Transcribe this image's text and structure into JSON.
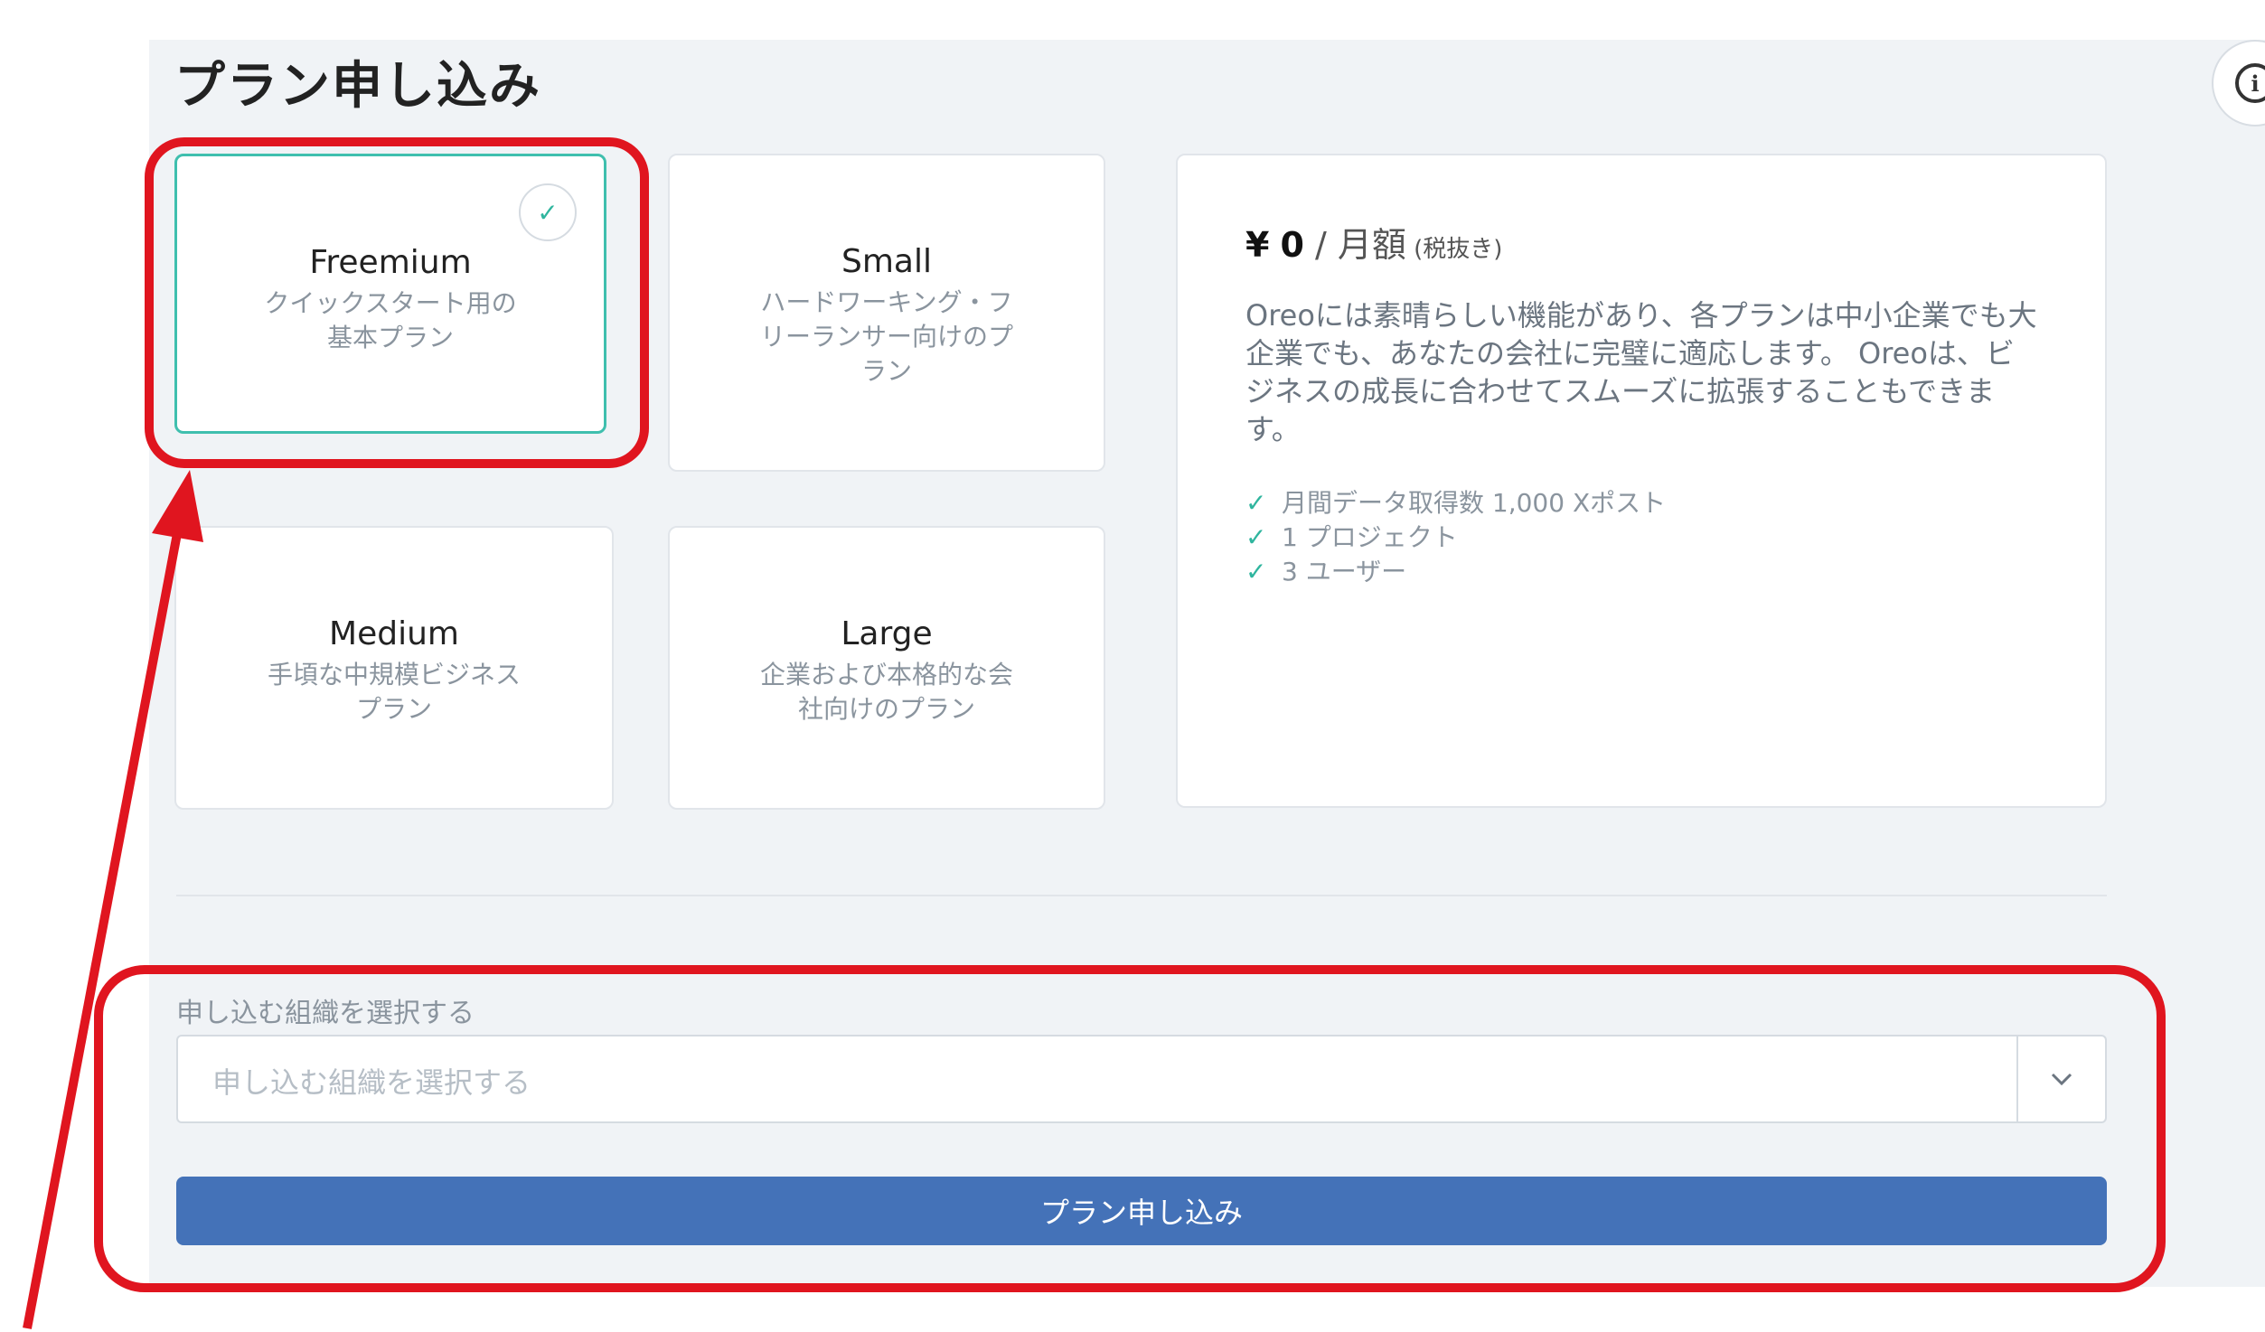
{
  "page_title": "プラン申し込み",
  "plans": [
    {
      "name": "Freemium",
      "description": "クイックスタート用の\n基本プラン",
      "selected": true
    },
    {
      "name": "Small",
      "description": "ハードワーキング・フ\nリーランサー向けのプ\nラン",
      "selected": false
    },
    {
      "name": "Medium",
      "description": "手頃な中規模ビジネス\nプラン",
      "selected": false
    },
    {
      "name": "Large",
      "description": "企業および本格的な会\n社向けのプラン",
      "selected": false
    }
  ],
  "details": {
    "currency": "¥",
    "price": "0",
    "per": " / 月額",
    "tax_note": " (税抜き)",
    "description": "Oreoには素晴らしい機能があり、各プランは中小企業でも大企業でも、あなたの会社に完璧に適応します。 Oreoは、ビジネスの成長に合わせてスムーズに拡張することもできます。",
    "features": [
      "月間データ取得数 1,000 Xポスト",
      "1 プロジェクト",
      "3 ユーザー"
    ]
  },
  "organization": {
    "label": "申し込む組織を選択する",
    "placeholder": "申し込む組織を選択する"
  },
  "submit_label": "プラン申し込み",
  "colors": {
    "accent": "#4472b8",
    "selected_border": "#3fbfae",
    "annotation": "#e0151f"
  },
  "icons": {
    "selected": "check-icon",
    "features": "check-icon",
    "dropdown": "chevron-down-icon",
    "info": "info-icon"
  }
}
